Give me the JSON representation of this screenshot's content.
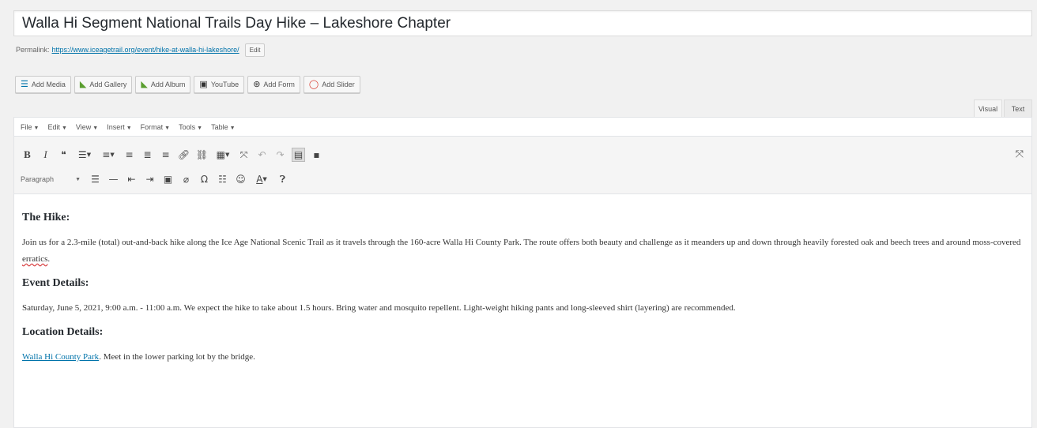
{
  "post_title": "Walla Hi Segment National Trails Day Hike – Lakeshore Chapter",
  "permalink": {
    "label": "Permalink:",
    "url": "https://www.iceagetrail.org/event/hike-at-walla-hi-lakeshore/",
    "edit_label": "Edit"
  },
  "media_buttons": [
    {
      "label": "Add Media",
      "icon": "media-icon",
      "glyph": "☰"
    },
    {
      "label": "Add Gallery",
      "icon": "gallery-icon",
      "glyph": "◣"
    },
    {
      "label": "Add Album",
      "icon": "album-icon",
      "glyph": "◣"
    },
    {
      "label": "YouTube",
      "icon": "youtube-icon",
      "glyph": "▣"
    },
    {
      "label": "Add Form",
      "icon": "form-icon",
      "glyph": "⊛"
    },
    {
      "label": "Add Slider",
      "icon": "slider-icon",
      "glyph": "◯"
    }
  ],
  "tabs": {
    "visual": "Visual",
    "text": "Text"
  },
  "menubar": [
    "File",
    "Edit",
    "View",
    "Insert",
    "Format",
    "Tools",
    "Table"
  ],
  "format_select": "Paragraph",
  "content": {
    "h1": "The Hike:",
    "p1_before": "Join us for a 2.3-mile (total) out-and-back hike along the Ice Age National Scenic Trail as it travels through the 160-acre Walla Hi County Park. The route offers both beauty and challenge as it meanders up and down through heavily forested oak and beech trees and around moss-covered ",
    "p1_misspelled": "erratics",
    "p1_after": ".",
    "h2": "Event Details:",
    "p2": "Saturday, June 5, 2021, 9:00 a.m. - 11:00 a.m. We expect the hike to take about 1.5 hours. Bring water and mosquito repellent. Light-weight hiking pants and long-sleeved shirt (layering) are recommended.",
    "h3": "Location Details:",
    "p3_link": "Walla Hi County Park",
    "p3_after": ". Meet in the lower parking lot by the bridge."
  },
  "colors": {
    "link": "#0073aa",
    "spellcheck": "#d63638"
  }
}
